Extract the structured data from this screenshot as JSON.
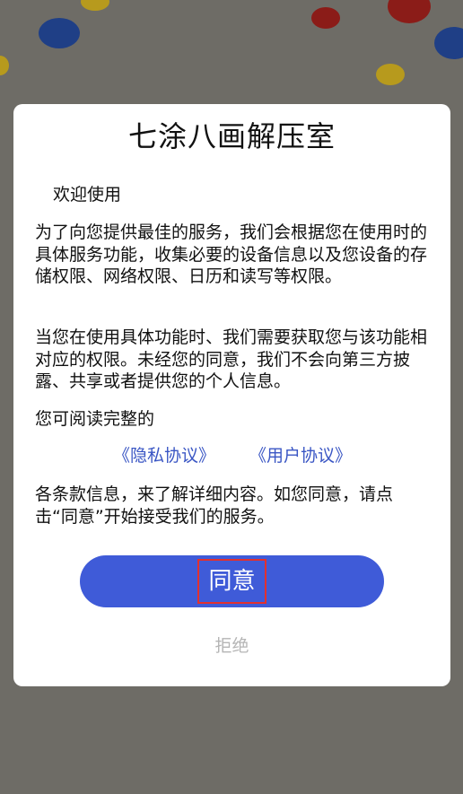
{
  "dialog": {
    "title": "七涂八画解压室",
    "welcome": "欢迎使用",
    "paragraph1": "为了向您提供最佳的服务，我们会根据您在使用时的具体服务功能，收集必要的设备信息以及您设备的存储权限、网络权限、日历和读写等权限。",
    "paragraph2": "当您在使用具体功能时、我们需要获取您与该功能相对应的权限。未经您的同意，我们不会向第三方披露、共享或者提供您的个人信息。",
    "paragraph3": "您可阅读完整的",
    "privacy_link": "《隐私协议》",
    "user_link": "《用户协议》",
    "paragraph4": "各条款信息，来了解详细内容。如您同意，请点击“同意”开始接受我们的服务。",
    "agree_label": "同意",
    "reject_label": "拒绝"
  },
  "colors": {
    "accent": "#3f5bd8",
    "link": "#3a56c4",
    "highlight_border": "#e2302f",
    "overlay": "#6e6c66"
  }
}
